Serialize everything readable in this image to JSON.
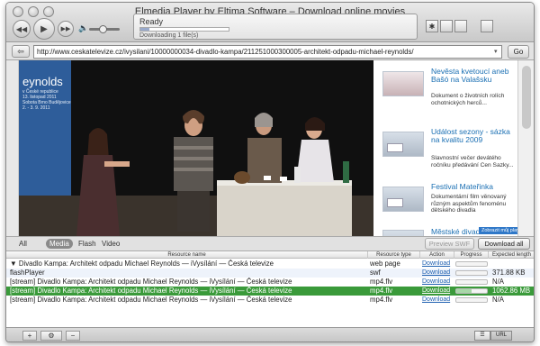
{
  "window": {
    "title": "Elmedia Player by Eltima Software – Download online movies"
  },
  "status": {
    "title": "Ready",
    "subtitle": "Downloading 1 file(s)",
    "progress": 0.1
  },
  "volume": {
    "level": 0.45
  },
  "url": {
    "value": "http://www.ceskatelevize.cz/ivysilani/10000000034-divadlo-kampa/211251000300005-architekt-odpadu-michael-reynolds/",
    "go_label": "Go"
  },
  "video": {
    "banner_title": "eynolds",
    "banner_lines": [
      "v České republice",
      "13. listopad 2011",
      "Sobota Brno Budějovice",
      "2. - 3. 9. 2011"
    ]
  },
  "sidebar_items": [
    {
      "title": "Nevěsta kvetoucí aneb Bašó na Valašsku",
      "desc": "Dokument o životních rolích ochotnických herců..."
    },
    {
      "title": "Událost sezony - sázka na kvalitu 2009",
      "desc": "Slavnostní večer devátého ročníku předávání Cen Sazky..."
    },
    {
      "title": "Festival Mateřinka",
      "desc": "Dokumentární film věnovaný různým aspektům fenoménu dětského divadla"
    },
    {
      "title": "Městské divadlo",
      "desc": ""
    }
  ],
  "playlist_tag": "Zobrazit můj playlist",
  "filters": {
    "all": "All",
    "media": "Media",
    "flash": "Flash",
    "video": "Video",
    "preview_label": "Preview SWF",
    "download_all_label": "Download all"
  },
  "table": {
    "headers": [
      "Resource name",
      "Resource type",
      "Action",
      "Progress",
      "Expected length"
    ],
    "rows": [
      {
        "name": "▼ Divadlo Kampa: Architekt odpadu Michael Reynolds — iVysílání — Česká televize",
        "type": "web page",
        "action": "Download",
        "progress": 0,
        "length": ""
      },
      {
        "name": "flashPlayer",
        "type": "swf",
        "action": "Download",
        "progress": 0,
        "length": "371.88 KB"
      },
      {
        "name": "[stream] Divadlo Kampa: Architekt odpadu Michael Reynolds — iVysílání — Česká televize",
        "type": "mp4.flv",
        "action": "Download",
        "progress": 0,
        "length": "N/A"
      },
      {
        "name": "[stream] Divadlo Kampa: Architekt odpadu Michael Reynolds — iVysílání — Česká televize",
        "type": "mp4.flv",
        "action": "Download",
        "progress": 0.5,
        "length": "1062.86 MB"
      },
      {
        "name": "[stream] Divadlo Kampa: Architekt odpadu Michael Reynolds — iVysílání — Česká televize",
        "type": "mp4.flv",
        "action": "Download",
        "progress": 0,
        "length": "N/A"
      }
    ]
  },
  "bottom": {
    "add": "+",
    "gear": "⚙",
    "remove": "−",
    "view_list": "☰",
    "view_url": "URL"
  },
  "colors": {
    "accent": "#1a6fb3",
    "selected_row": "#3a9a3a",
    "link": "#1e5fb0"
  }
}
